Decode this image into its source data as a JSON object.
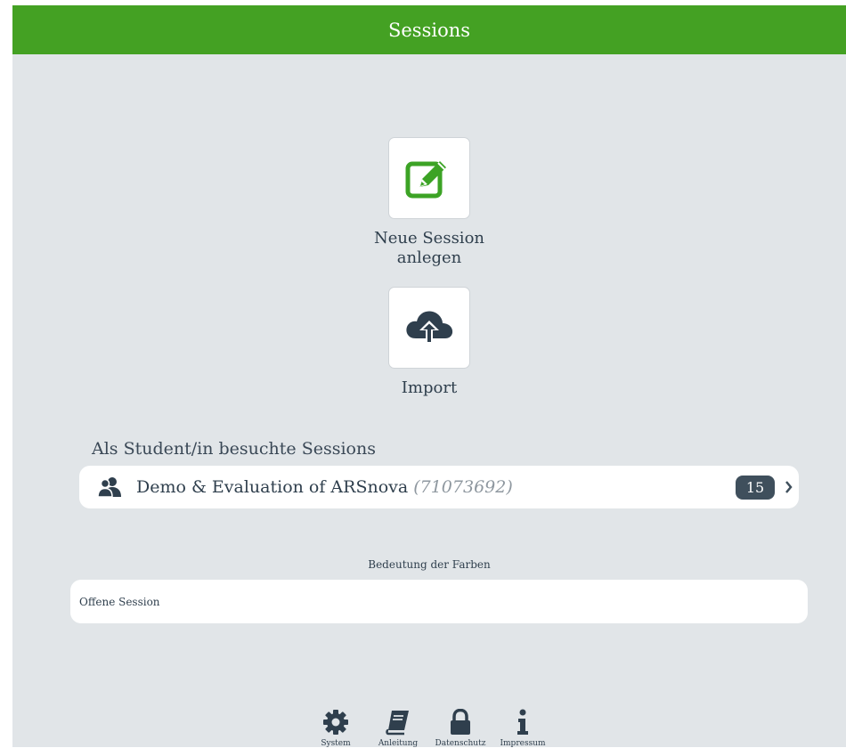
{
  "header": {
    "title": "Sessions"
  },
  "actions": [
    {
      "label": "Neue Session anlegen",
      "icon": "edit-icon"
    },
    {
      "label": "Import",
      "icon": "cloud-upload-icon"
    }
  ],
  "visited": {
    "title": "Als Student/in besuchte Sessions",
    "sessions": [
      {
        "name": "Demo & Evaluation of ARSnova",
        "key": "(71073692)",
        "count": "15"
      }
    ]
  },
  "legend": {
    "title": "Bedeutung der Farben",
    "items": [
      "Offene Session"
    ]
  },
  "footer": {
    "items": [
      {
        "label": "System",
        "icon": "gear-icon"
      },
      {
        "label": "Anleitung",
        "icon": "book-icon"
      },
      {
        "label": "Datenschutz",
        "icon": "lock-icon"
      },
      {
        "label": "Impressum",
        "icon": "info-icon"
      }
    ]
  },
  "colors": {
    "header": "#44a123",
    "accent": "#3ca325",
    "badge": "#3f4f5c",
    "background": "#e1e5e8"
  }
}
